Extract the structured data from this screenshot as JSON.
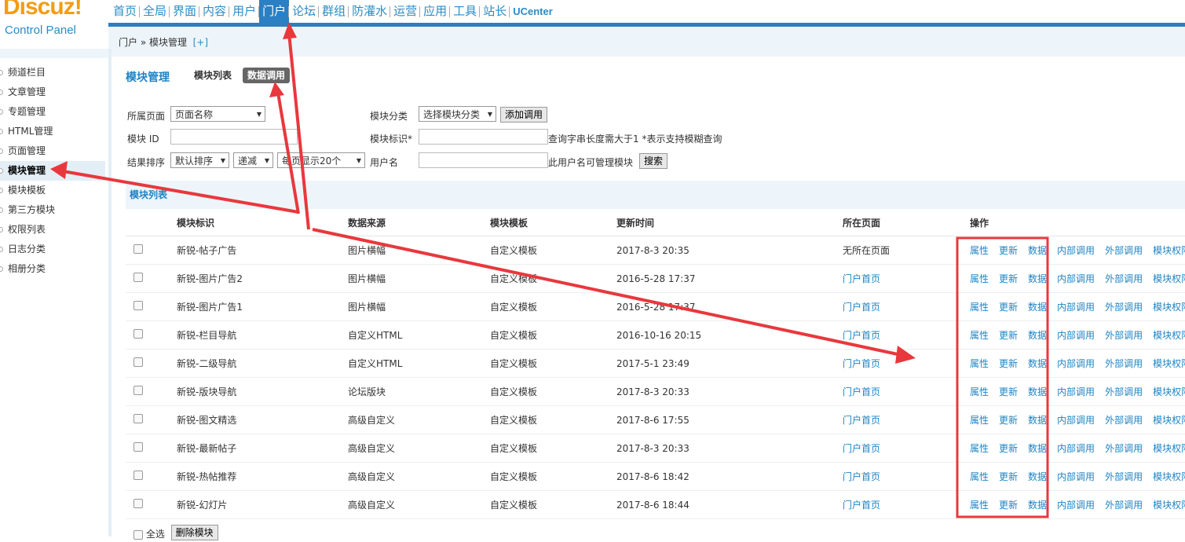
{
  "logo": {
    "name": "Discuz!",
    "subtitle": "Control Panel"
  },
  "topnav": {
    "items": [
      "首页",
      "全局",
      "界面",
      "内容",
      "用户",
      "门户",
      "论坛",
      "群组",
      "防灌水",
      "运营",
      "应用",
      "工具",
      "站长",
      "UCenter"
    ],
    "active": "门户"
  },
  "breadcrumb": {
    "path": "门户 » 模块管理",
    "add": "[+]"
  },
  "sidebar": {
    "items": [
      "频道栏目",
      "文章管理",
      "专题管理",
      "HTML管理",
      "页面管理",
      "模块管理",
      "模块模板",
      "第三方模块",
      "权限列表",
      "日志分类",
      "相册分类"
    ],
    "active": "模块管理"
  },
  "main": {
    "title": "模块管理",
    "tabs": [
      "模块列表",
      "数据调用"
    ],
    "active_tab": "数据调用",
    "filters": {
      "page_label": "所属页面",
      "page_select": "页面名称",
      "category_label": "模块分类",
      "category_select": "选择模块分类",
      "add_button": "添加调用",
      "id_label": "模块 ID",
      "tag_label": "模块标识*",
      "tag_hint": "查询字串长度需大于1  *表示支持模糊查询",
      "sort_label": "结果排序",
      "sort_select": "默认排序",
      "order_select": "递减",
      "perpage_select": "每页显示20个",
      "user_label": "用户名",
      "user_hint": "此用户名可管理模块",
      "search_button": "搜索"
    },
    "list_title": "模块列表",
    "columns": [
      "模块标识",
      "数据来源",
      "模块模板",
      "更新时间",
      "所在页面",
      "操作"
    ],
    "rows": [
      {
        "tag": "新锐-帖子广告",
        "source": "图片横幅",
        "template": "自定义模板",
        "updated": "2017-8-3 20:35",
        "page": "无所在页面"
      },
      {
        "tag": "新锐-图片广告2",
        "source": "图片横幅",
        "template": "自定义模板",
        "updated": "2016-5-28 17:37",
        "page": "门户首页"
      },
      {
        "tag": "新锐-图片广告1",
        "source": "图片横幅",
        "template": "自定义模板",
        "updated": "2016-5-28 17:37",
        "page": "门户首页"
      },
      {
        "tag": "新锐-栏目导航",
        "source": "自定义HTML",
        "template": "自定义模板",
        "updated": "2016-10-16 20:15",
        "page": "门户首页"
      },
      {
        "tag": "新锐-二级导航",
        "source": "自定义HTML",
        "template": "自定义模板",
        "updated": "2017-5-1 23:49",
        "page": "门户首页"
      },
      {
        "tag": "新锐-版块导航",
        "source": "论坛版块",
        "template": "自定义模板",
        "updated": "2017-8-3 20:33",
        "page": "门户首页"
      },
      {
        "tag": "新锐-图文精选",
        "source": "高级自定义",
        "template": "自定义模板",
        "updated": "2017-8-6 17:55",
        "page": "门户首页"
      },
      {
        "tag": "新锐-最新帖子",
        "source": "高级自定义",
        "template": "自定义模板",
        "updated": "2017-8-3 20:33",
        "page": "门户首页"
      },
      {
        "tag": "新锐-热帖推荐",
        "source": "高级自定义",
        "template": "自定义模板",
        "updated": "2017-8-6 18:42",
        "page": "门户首页"
      },
      {
        "tag": "新锐-幻灯片",
        "source": "高级自定义",
        "template": "自定义模板",
        "updated": "2017-8-6 18:44",
        "page": "门户首页"
      }
    ],
    "ops": [
      "属性",
      "更新",
      "数据",
      "内部调用",
      "外部调用",
      "模块权限"
    ],
    "select_all": "全选",
    "delete_button": "删除模块"
  },
  "colors": {
    "accent": "#2b7fc3",
    "link": "#1d84c5",
    "annotation": "#e8383d",
    "logo": "#f39c12"
  }
}
